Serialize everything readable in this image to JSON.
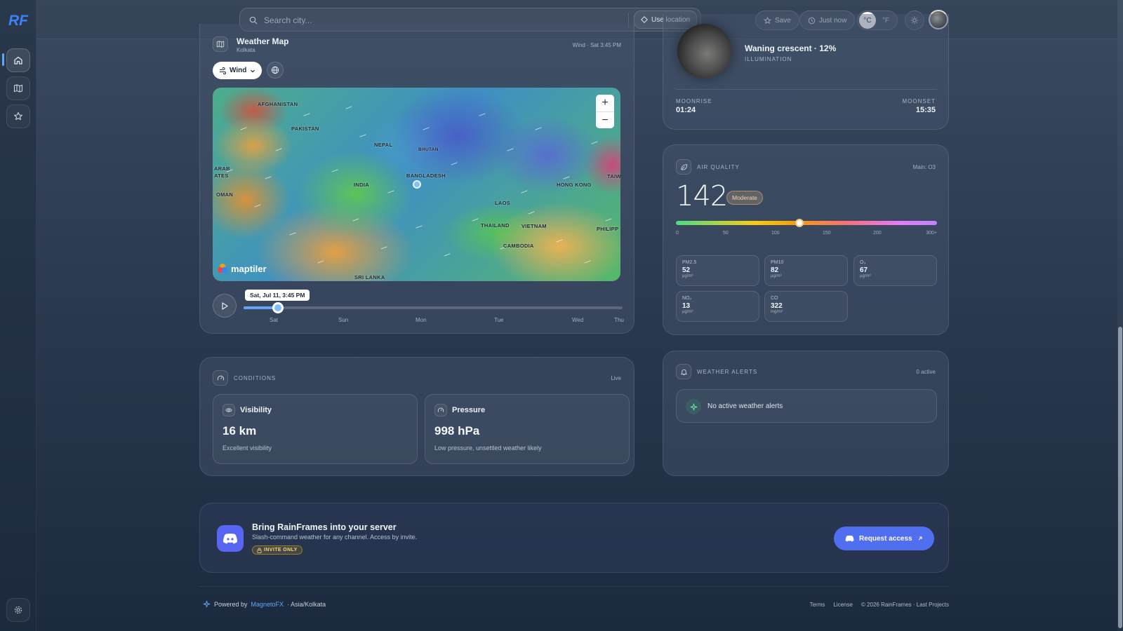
{
  "sidebar": {
    "logo": "RF",
    "items": [
      {
        "name": "home",
        "icon": "home-icon"
      },
      {
        "name": "map",
        "icon": "map-icon"
      },
      {
        "name": "favorites",
        "icon": "star-icon"
      }
    ],
    "settings_icon": "gear-icon"
  },
  "topbar": {
    "search_placeholder": "Search city...",
    "use_location": "Use location",
    "save": "Save",
    "last_updated": "Just now",
    "unit_c": "°C",
    "unit_f": "°F"
  },
  "map_card": {
    "title": "Weather Map",
    "subtitle": "Kolkata",
    "meta": "Wind · Sat 3:45 PM",
    "layer_select": "Wind",
    "labels": [
      "AFGHANISTAN",
      "PAKISTAN",
      "NEPAL",
      "BHUTAN",
      "ARAB",
      "ATES",
      "OMAN",
      "INDIA",
      "BANGLADESH",
      "HONG KONG",
      "TAIWA",
      "LAOS",
      "THAILAND",
      "VIETNAM",
      "PHILIPP",
      "CAMBODIA",
      "SRI LANKA"
    ],
    "attribution": "maptiler",
    "timeline": {
      "tooltip": "Sat, Jul 11, 3:45 PM",
      "progress": 0.09,
      "days": [
        "Sat",
        "Sun",
        "Mon",
        "Tue",
        "Wed",
        "Thu"
      ]
    }
  },
  "moon": {
    "phase": "Waning crescent · 12%",
    "illumination_label": "ILLUMINATION",
    "moonrise_label": "MOONRISE",
    "moonrise": "01:24",
    "moonset_label": "MOONSET",
    "moonset": "15:35"
  },
  "air_quality": {
    "title": "AIR QUALITY",
    "main": "Main: O3",
    "aqi": "142",
    "level": "Moderate",
    "scale_position": 0.473,
    "scale_labels": [
      "0",
      "50",
      "100",
      "150",
      "200",
      "300+"
    ],
    "pollutants": [
      {
        "name": "PM2.5",
        "value": "52",
        "unit": "µg/m³"
      },
      {
        "name": "PM10",
        "value": "82",
        "unit": "µg/m³"
      },
      {
        "name": "O₃",
        "value": "67",
        "unit": "µg/m³"
      },
      {
        "name": "NO₂",
        "value": "13",
        "unit": "µg/m³"
      },
      {
        "name": "CO",
        "value": "322",
        "unit": "mg/m³"
      }
    ]
  },
  "conditions": {
    "title": "CONDITIONS",
    "live": "Live",
    "visibility": {
      "label": "Visibility",
      "value": "16 km",
      "note": "Excellent visibility"
    },
    "pressure": {
      "label": "Pressure",
      "value": "998 hPa",
      "note": "Low pressure, unsettled weather likely"
    }
  },
  "alerts": {
    "title": "WEATHER ALERTS",
    "count": "0 active",
    "empty": "No active weather alerts"
  },
  "discord": {
    "title": "Bring RainFrames into your server",
    "subtitle": "Slash-command weather for any channel. Access by invite.",
    "badge": "INVITE ONLY",
    "cta": "Request access"
  },
  "footer": {
    "powered_prefix": "Powered by",
    "powered_link": "MagnetoFX",
    "timezone": "· Asia/Kolkata",
    "terms": "Terms",
    "license": "License",
    "copyright": "© 2026 RainFrames · Last Projects"
  },
  "colors": {
    "accent": "#60a5fa",
    "button_primary": "#4f6ff0",
    "moderate_badge": "#e1b47c"
  }
}
